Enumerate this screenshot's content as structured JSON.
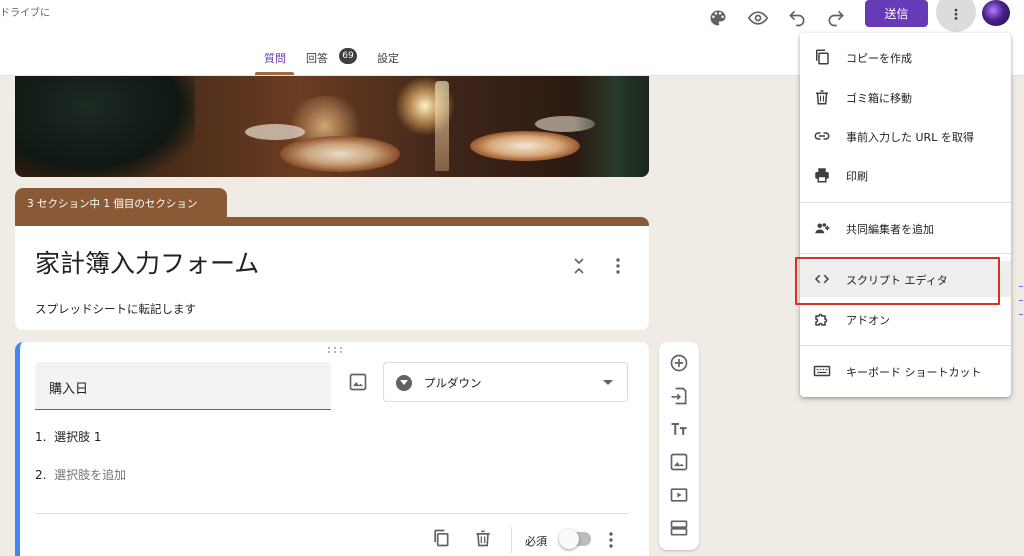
{
  "header": {
    "drive_text": "ドライブに",
    "send_label": "送信",
    "icons": [
      "palette-icon",
      "eye-icon",
      "undo-icon",
      "redo-icon",
      "more-vert-icon"
    ]
  },
  "tabs": {
    "questions": "質問",
    "responses": "回答",
    "responses_count": "69",
    "settings": "設定"
  },
  "section": {
    "tag": "3 セクション中 1 個目のセクション"
  },
  "form": {
    "title": "家計簿入力フォーム",
    "description": "スプレッドシートに転記します"
  },
  "question": {
    "title": "購入日",
    "type": "プルダウン",
    "options": [
      "選択肢 1"
    ],
    "option_numbers": [
      "1.",
      "2."
    ],
    "add_option": "選択肢を追加",
    "required_label": "必須",
    "required": false
  },
  "menu": {
    "items": [
      {
        "label": "コピーを作成",
        "icon": "copy-icon"
      },
      {
        "label": "ゴミ箱に移動",
        "icon": "trash-icon"
      },
      {
        "label": "事前入力した URL を取得",
        "icon": "link-icon"
      },
      {
        "label": "印刷",
        "icon": "print-icon"
      },
      {
        "label": "共同編集者を追加",
        "icon": "add-people-icon"
      },
      {
        "label": "スクリプト エディタ",
        "icon": "code-icon"
      },
      {
        "label": "アドオン",
        "icon": "puzzle-icon"
      },
      {
        "label": "キーボード ショートカット",
        "icon": "keyboard-icon"
      }
    ],
    "highlighted_item": "スクリプト エディタ",
    "highlight_color": "#d93025"
  },
  "colors": {
    "accent": "#673ab7",
    "section_brown": "#8a5a36",
    "question_border": "#4285f4",
    "background": "#f0ebe5"
  }
}
